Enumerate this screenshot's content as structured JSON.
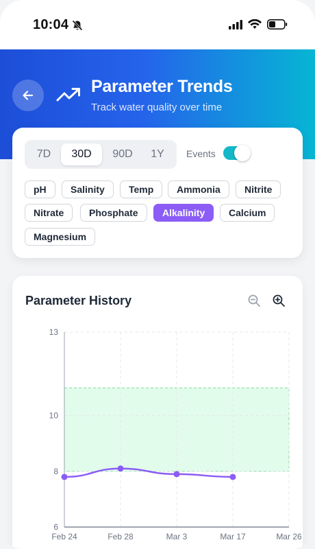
{
  "status_bar": {
    "time": "10:04"
  },
  "header": {
    "title": "Parameter Trends",
    "subtitle": "Track water quality over time"
  },
  "filters": {
    "ranges": [
      "7D",
      "30D",
      "90D",
      "1Y"
    ],
    "selected_range": "30D",
    "events_label": "Events",
    "events_enabled": true,
    "parameters": [
      "pH",
      "Salinity",
      "Temp",
      "Ammonia",
      "Nitrite",
      "Nitrate",
      "Phosphate",
      "Alkalinity",
      "Calcium",
      "Magnesium"
    ],
    "selected_parameter": "Alkalinity"
  },
  "chart": {
    "title": "Parameter History"
  },
  "colors": {
    "accent": "#8b5cf6",
    "header_start": "#1d4ed8",
    "header_end": "#06b6d4",
    "target_range": "#dcfce7",
    "toggle": "#14b8c8"
  },
  "chart_data": {
    "type": "line",
    "x_categories": [
      "Feb 24",
      "Feb 28",
      "Mar 3",
      "Mar 17",
      "Mar 26"
    ],
    "series": [
      {
        "points": [
          {
            "x": "Feb 24",
            "y": 7.8
          },
          {
            "x": "Feb 28",
            "y": 8.1
          },
          {
            "x": "Mar 3",
            "y": 7.9
          },
          {
            "x": "Mar 17",
            "y": 7.8
          }
        ]
      }
    ],
    "y_ticks": [
      6,
      8,
      10,
      13
    ],
    "ylim": [
      6,
      13
    ],
    "target_band": [
      8,
      11
    ],
    "grid": true
  }
}
